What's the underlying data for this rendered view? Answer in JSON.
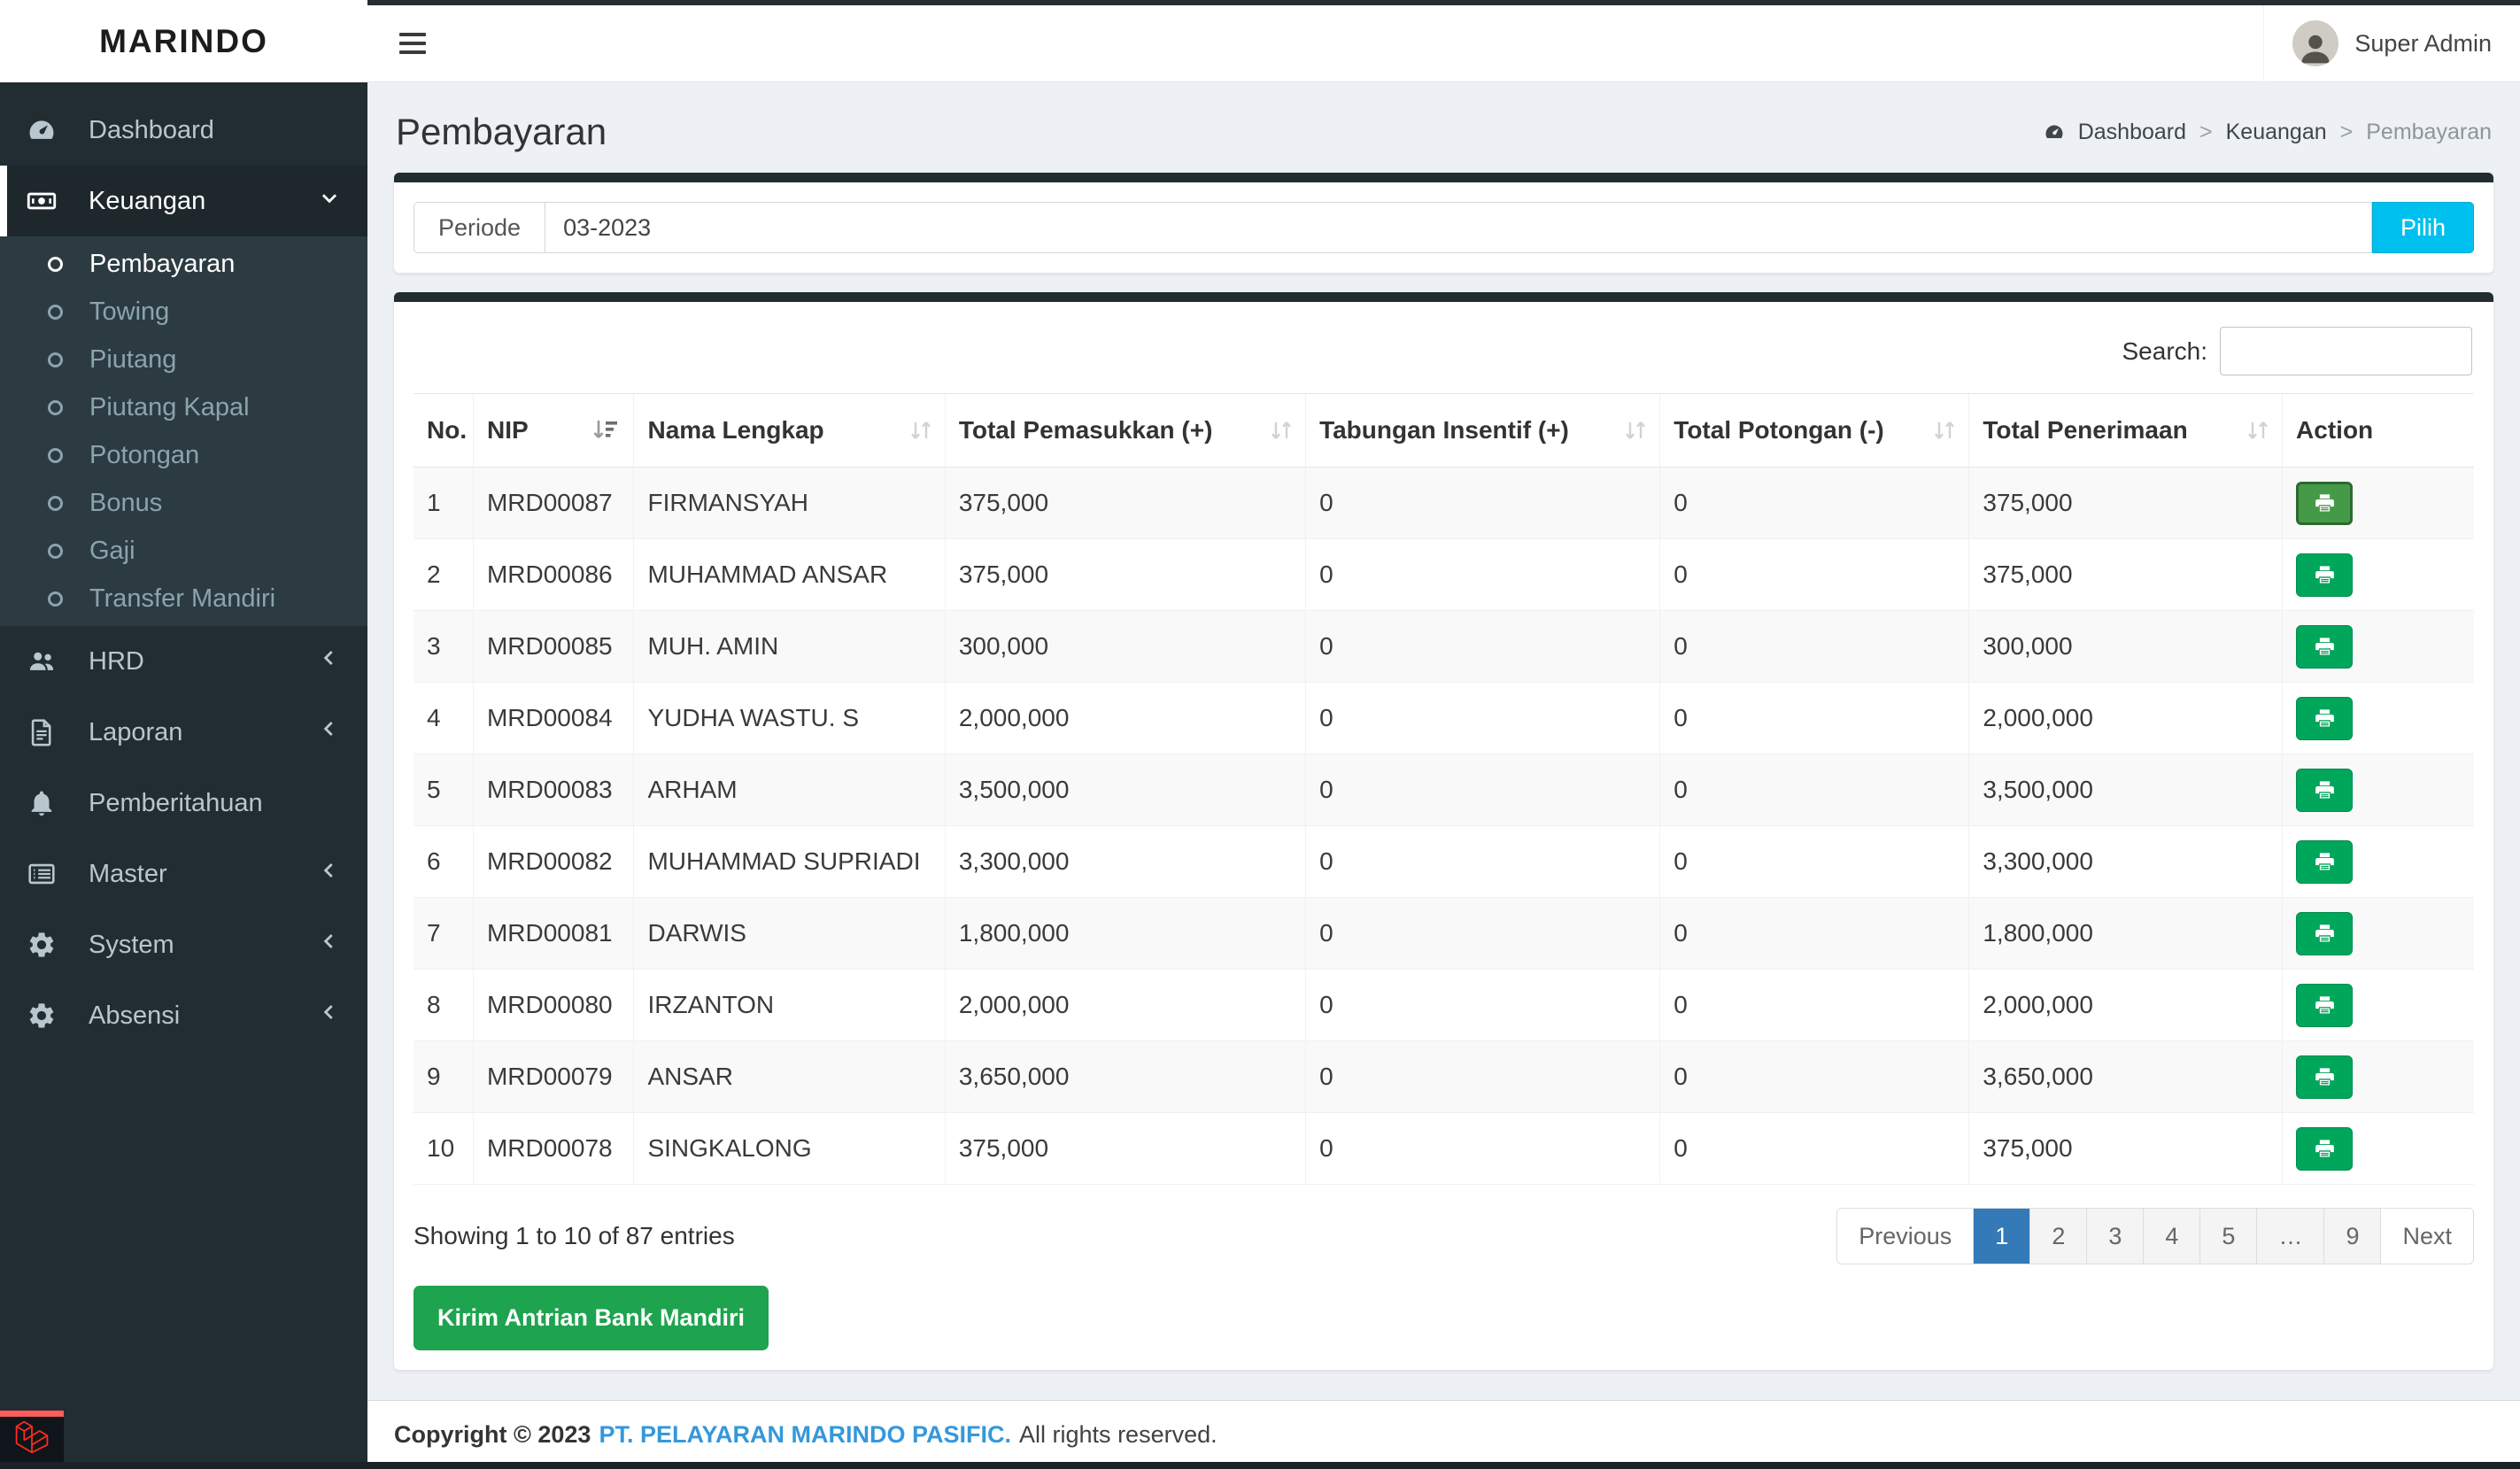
{
  "brand": {
    "name": "MARINDO"
  },
  "topbar": {
    "user": "Super Admin"
  },
  "sidebar": {
    "items": [
      {
        "label": "Dashboard",
        "icon": "tachometer-icon",
        "active": false
      },
      {
        "label": "Keuangan",
        "icon": "money-icon",
        "active": true,
        "chevron": "down",
        "children": [
          {
            "label": "Pembayaran",
            "active": true
          },
          {
            "label": "Towing",
            "active": false
          },
          {
            "label": "Piutang",
            "active": false
          },
          {
            "label": "Piutang Kapal",
            "active": false
          },
          {
            "label": "Potongan",
            "active": false
          },
          {
            "label": "Bonus",
            "active": false
          },
          {
            "label": "Gaji",
            "active": false
          },
          {
            "label": "Transfer Mandiri",
            "active": false
          }
        ]
      },
      {
        "label": "HRD",
        "icon": "users-icon",
        "chevron": "left"
      },
      {
        "label": "Laporan",
        "icon": "file-icon",
        "chevron": "left"
      },
      {
        "label": "Pemberitahuan",
        "icon": "bell-icon"
      },
      {
        "label": "Master",
        "icon": "list-icon",
        "chevron": "left"
      },
      {
        "label": "System",
        "icon": "gear-icon",
        "chevron": "left"
      },
      {
        "label": "Absensi",
        "icon": "gear-icon",
        "chevron": "left"
      }
    ]
  },
  "page": {
    "title": "Pembayaran",
    "separator": ">",
    "breadcrumb": [
      "Dashboard",
      "Keuangan",
      "Pembayaran"
    ]
  },
  "filter": {
    "label": "Periode",
    "value": "03-2023",
    "button": "Pilih"
  },
  "table": {
    "search_label": "Search:",
    "columns": [
      "No.",
      "NIP",
      "Nama Lengkap",
      "Total Pemasukkan (+)",
      "Tabungan Insentif (+)",
      "Total Potongan (-)",
      "Total Penerimaan",
      "Action"
    ],
    "rows": [
      {
        "no": "1",
        "nip": "MRD00087",
        "nama": "FIRMANSYAH",
        "pemasukkan": "375,000",
        "tabungan": "0",
        "potongan": "0",
        "penerimaan": "375,000"
      },
      {
        "no": "2",
        "nip": "MRD00086",
        "nama": "MUHAMMAD ANSAR",
        "pemasukkan": "375,000",
        "tabungan": "0",
        "potongan": "0",
        "penerimaan": "375,000"
      },
      {
        "no": "3",
        "nip": "MRD00085",
        "nama": "MUH. AMIN",
        "pemasukkan": "300,000",
        "tabungan": "0",
        "potongan": "0",
        "penerimaan": "300,000"
      },
      {
        "no": "4",
        "nip": "MRD00084",
        "nama": "YUDHA WASTU. S",
        "pemasukkan": "2,000,000",
        "tabungan": "0",
        "potongan": "0",
        "penerimaan": "2,000,000"
      },
      {
        "no": "5",
        "nip": "MRD00083",
        "nama": "ARHAM",
        "pemasukkan": "3,500,000",
        "tabungan": "0",
        "potongan": "0",
        "penerimaan": "3,500,000"
      },
      {
        "no": "6",
        "nip": "MRD00082",
        "nama": "MUHAMMAD SUPRIADI",
        "pemasukkan": "3,300,000",
        "tabungan": "0",
        "potongan": "0",
        "penerimaan": "3,300,000"
      },
      {
        "no": "7",
        "nip": "MRD00081",
        "nama": "DARWIS",
        "pemasukkan": "1,800,000",
        "tabungan": "0",
        "potongan": "0",
        "penerimaan": "1,800,000"
      },
      {
        "no": "8",
        "nip": "MRD00080",
        "nama": "IRZANTON",
        "pemasukkan": "2,000,000",
        "tabungan": "0",
        "potongan": "0",
        "penerimaan": "2,000,000"
      },
      {
        "no": "9",
        "nip": "MRD00079",
        "nama": "ANSAR",
        "pemasukkan": "3,650,000",
        "tabungan": "0",
        "potongan": "0",
        "penerimaan": "3,650,000"
      },
      {
        "no": "10",
        "nip": "MRD00078",
        "nama": "SINGKALONG",
        "pemasukkan": "375,000",
        "tabungan": "0",
        "potongan": "0",
        "penerimaan": "375,000"
      }
    ],
    "info": "Showing 1 to 10 of 87 entries"
  },
  "pagination": {
    "previous": "Previous",
    "pages": [
      "1",
      "2",
      "3",
      "4",
      "5",
      "…",
      "9"
    ],
    "active": "1",
    "next": "Next"
  },
  "actions": {
    "kirim": "Kirim Antrian Bank Mandiri"
  },
  "footer": {
    "copyright": "Copyright © 2023",
    "company": "PT. PELAYARAN MARINDO PASIFIC.",
    "rights": "All rights reserved."
  },
  "colors": {
    "sidebar_bg": "#222d32",
    "submenu_bg": "#2c3b41",
    "sidebar_text": "#b8c7ce",
    "body_bg": "#edf0f4",
    "card_top_border": "#222d32",
    "info_button": "#00c0ef",
    "success_button": "#00a65a",
    "kirim_button": "#1ea34e",
    "pagination_active": "#337ab7",
    "link_blue": "#3498db",
    "laravel_red": "#ff2d20"
  }
}
